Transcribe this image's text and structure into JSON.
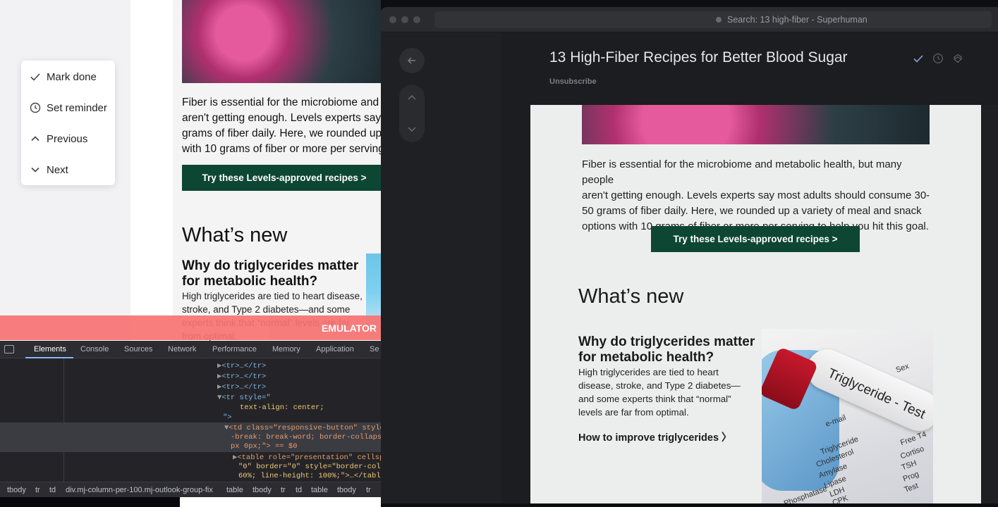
{
  "left_menu": {
    "items": [
      {
        "label": "Mark done",
        "icon": "check-icon"
      },
      {
        "label": "Set reminder",
        "icon": "clock-icon"
      },
      {
        "label": "Previous",
        "icon": "chevron-up-icon"
      },
      {
        "label": "Next",
        "icon": "chevron-down-icon"
      }
    ]
  },
  "left_email": {
    "paragraph_lines": [
      "Fiber is essential for the microbiome and m",
      "aren't getting enough. Levels experts say m",
      "grams of fiber daily. Here, we rounded up a",
      "with 10 grams of fiber or more per serving t"
    ],
    "cta": "Try these Levels-approved recipes >",
    "whats_new": "What’s new",
    "article_title": "Why do triglycerides matter for metabolic health?",
    "article_body": "High triglycerides are tied to heart disease, stroke, and Type 2 diabetes—and some experts think that “normal” levels are far from optimal."
  },
  "emulator_label": "EMULATOR",
  "devtools": {
    "tabs": [
      "Elements",
      "Console",
      "Sources",
      "Network",
      "Performance",
      "Memory",
      "Application",
      "Se"
    ],
    "active_tab": "Elements",
    "code_lines": {
      "tr1": "<tr>…</tr>",
      "tr2": "<tr>…</tr>",
      "tr3": "<tr>…</tr>",
      "tr4_open": "<tr style=\"",
      "tr4_style": "text-align: center;",
      "tr4_close": "\">",
      "td_open": "<td class=\"responsive-button\" style",
      "td_style": "-break: break-word; border-collapse",
      "td_close": "px 0px;\"> == $0",
      "table_open": "<table role=\"presentation\" cellsp",
      "table_attrs": "\"0\" border=\"0\" style=\"border-coll",
      "table_close": "60%; line-height: 100%;\">…</tabl"
    },
    "breadcrumbs": [
      "tbody",
      "tr",
      "td",
      "div.mj-column-per-100.mj-outlook-group-fix",
      "table",
      "tbody",
      "tr",
      "td",
      "table",
      "tbody",
      "tr"
    ]
  },
  "superhuman": {
    "window_title": "Search: 13 high-fiber - Superhuman",
    "subject": "13 High-Fiber Recipes for Better Blood Sugar",
    "unsubscribe": "Unsubscribe",
    "paragraph_lines": [
      "Fiber is essential for the microbiome and metabolic health, but many people",
      "aren't getting enough. Levels experts say most adults should consume 30-",
      "50 grams of fiber daily. Here, we rounded up a variety of meal and snack",
      "options with 10 grams of fiber or more per serving to help you hit this goal."
    ],
    "cta": "Try these Levels-approved recipes >",
    "whats_new": "What’s new",
    "article_title": "Why do triglycerides matter for metabolic health?",
    "article_body": "High triglycerides are tied to heart disease, stroke, and Type 2 diabetes—and some experts think that “normal” levels are far from optimal.",
    "article_link": "How to improve triglycerides 〉",
    "image_text": {
      "tube": "Triglyceride - Test",
      "form": [
        "e-mail",
        "Triglyceride",
        "Cholesterol",
        "Amylase",
        "Lipase",
        "LDH",
        "CPK",
        "Phosphatase",
        "Free T4",
        "Cortiso",
        "TSH",
        "Prog",
        "Test",
        "Sex"
      ]
    }
  },
  "colors": {
    "cta_green": "#0e4634",
    "emulator_red": "#f77272",
    "devtools_bg": "#242428",
    "superhuman_bg": "#1c1d20",
    "email_bg": "#eceeed"
  }
}
